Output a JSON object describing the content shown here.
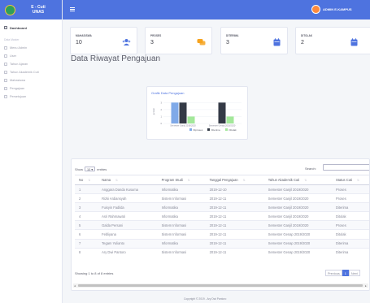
{
  "brand": {
    "line1": "E - Cuti",
    "line2": "UNAS"
  },
  "sidebar": {
    "dashboard": "Dashboard",
    "heading": "Data Master",
    "items": [
      {
        "label": "Menu Admin",
        "icon": "folder-icon"
      },
      {
        "label": "User",
        "icon": "folder-icon"
      },
      {
        "label": "Tahun Ajaran",
        "icon": "folder-icon"
      },
      {
        "label": "Tahun Akademik Cuti",
        "icon": "folder-icon"
      },
      {
        "label": "Mahasiswa",
        "icon": "folder-icon"
      },
      {
        "label": "Pengajuan",
        "icon": "folder-icon"
      },
      {
        "label": "Persetujuan",
        "icon": "folder-icon"
      }
    ]
  },
  "topbar": {
    "user_name": "ADMIN E-KAMPUS"
  },
  "cards": [
    {
      "label": "MAHASISWA",
      "value": "10",
      "icon": "users-icon",
      "color": "#4e73df"
    },
    {
      "label": "PROSES",
      "value": "3",
      "icon": "comments-icon",
      "color": "#f6a31e"
    },
    {
      "label": "DITERIMA",
      "value": "3",
      "icon": "calendar-icon",
      "color": "#4e73df"
    },
    {
      "label": "DITOLAK",
      "value": "2",
      "icon": "calendar-icon",
      "color": "#4e73df"
    }
  ],
  "page_title": "Data Riwayat Pengajuan",
  "chart_title": "Grafik Data Pengajuan",
  "chart_data": {
    "type": "bar",
    "categories": [
      "Semester Ganjil 2019/2020",
      "Semester Genap 2019/2020"
    ],
    "series": [
      {
        "name": "Diproses",
        "color": "#7fa9e8",
        "values": [
          3,
          0
        ]
      },
      {
        "name": "Diterima",
        "color": "#343a46",
        "values": [
          3,
          3
        ]
      },
      {
        "name": "Ditolak",
        "color": "#a3e89a",
        "values": [
          1,
          1
        ]
      }
    ],
    "ylabel": "jumlah",
    "yticks": [
      "0",
      "1",
      "2",
      "3"
    ],
    "ylim": [
      0,
      3.5
    ]
  },
  "table": {
    "show_label": "Show",
    "show_value": "10",
    "entries_label": "entries",
    "search_label": "Search:",
    "columns": [
      "No",
      "Nama",
      "Program Studi",
      "Tanggal Pengajuan",
      "Tahun Akademik Cuti",
      "Status Cuti"
    ],
    "rows": [
      [
        "1",
        "Anggara Danda Kusuma",
        "Informatika",
        "2019-12-10",
        "Semester Ganjil 2019/2020",
        "Proses"
      ],
      [
        "2",
        "Rizki Ardiansyah",
        "Sistem Informasi",
        "2019-12-11",
        "Semester Ganjil 2019/2020",
        "Proses"
      ],
      [
        "3",
        "Fuisyin Fadilda",
        "Informatika",
        "2019-12-11",
        "Semester Ganjil 2019/2020",
        "Diterima"
      ],
      [
        "4",
        "Asri Rahmawati",
        "Informatika",
        "2019-12-11",
        "Semester Ganjil 2019/2020",
        "Ditolak"
      ],
      [
        "5",
        "Galda Persani",
        "Sistem Informasi",
        "2019-12-11",
        "Semester Ganjil 2019/2020",
        "Proses"
      ],
      [
        "6",
        "Febliyana",
        "Sistem Informasi",
        "2019-12-11",
        "Semester Genap 2019/2020",
        "Ditolak"
      ],
      [
        "7",
        "Tegam Yulianto",
        "Informatika",
        "2019-12-11",
        "Semester Genap 2019/2020",
        "Diterima"
      ],
      [
        "8",
        "Ary Dwi Pantoro",
        "Sistem Informasi",
        "2019-12-11",
        "Semester Genap 2019/2020",
        "Diterima"
      ]
    ],
    "info": "Showing 1 to 8 of 8 entries",
    "pager": {
      "previous": "Previous",
      "page": "1",
      "next": "Next"
    }
  },
  "footer": "Copyright © 2019 - Ary Dwi Pantoro"
}
